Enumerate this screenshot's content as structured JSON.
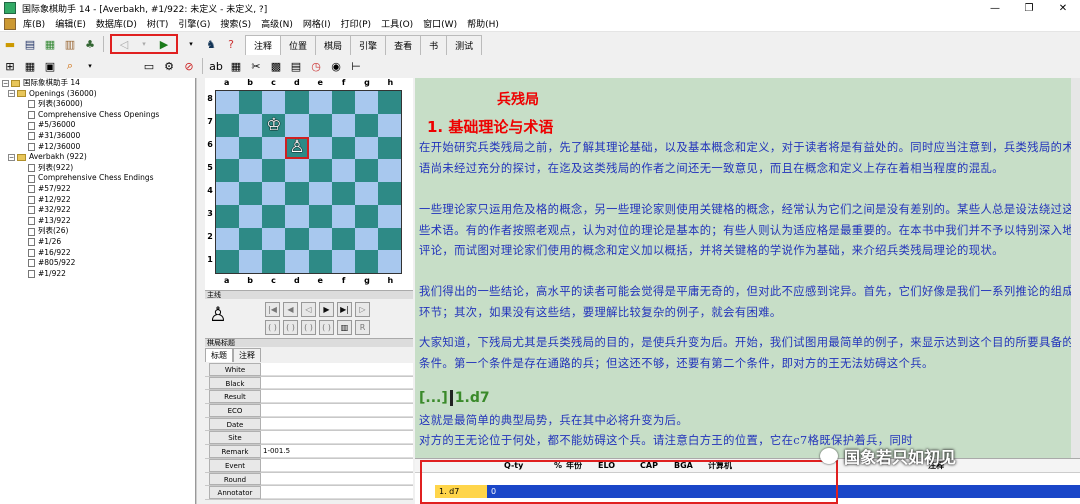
{
  "window": {
    "title": "国际象棋助手 14 - [Averbakh, #1/922: 未定义 - 未定义, ?]",
    "controls": [
      "minimize-icon",
      "restore-icon",
      "close-icon"
    ]
  },
  "menu": [
    "库(B)",
    "编辑(E)",
    "数据库(D)",
    "树(T)",
    "引擎(G)",
    "搜索(S)",
    "高级(N)",
    "网格(I)",
    "打印(P)",
    "工具(O)",
    "窗口(W)",
    "帮助(H)"
  ],
  "toolbar": {
    "tabs": [
      "注释",
      "位置",
      "棋局",
      "引擎",
      "查看",
      "书",
      "测试"
    ],
    "active_tab": "注释"
  },
  "tree": {
    "root": "国际象棋助手 14",
    "items": [
      {
        "label": "Openings (36000)",
        "level": 1,
        "type": "folder"
      },
      {
        "label": "列表(36000)",
        "level": 2,
        "type": "doc"
      },
      {
        "label": "Comprehensive Chess Openings",
        "level": 2,
        "type": "doc"
      },
      {
        "label": "#5/36000",
        "level": 2,
        "type": "doc"
      },
      {
        "label": "#31/36000",
        "level": 2,
        "type": "doc"
      },
      {
        "label": "#12/36000",
        "level": 2,
        "type": "doc"
      },
      {
        "label": "Averbakh (922)",
        "level": 1,
        "type": "folder"
      },
      {
        "label": "列表(922)",
        "level": 2,
        "type": "doc"
      },
      {
        "label": "Comprehensive Chess Endings",
        "level": 2,
        "type": "doc"
      },
      {
        "label": "#57/922",
        "level": 2,
        "type": "doc"
      },
      {
        "label": "#12/922",
        "level": 2,
        "type": "doc"
      },
      {
        "label": "#32/922",
        "level": 2,
        "type": "doc"
      },
      {
        "label": "#13/922",
        "level": 2,
        "type": "doc"
      },
      {
        "label": "列表(26)",
        "level": 2,
        "type": "doc"
      },
      {
        "label": "#1/26",
        "level": 2,
        "type": "doc"
      },
      {
        "label": "#16/922",
        "level": 2,
        "type": "doc"
      },
      {
        "label": "#805/922",
        "level": 2,
        "type": "doc"
      },
      {
        "label": "#1/922",
        "level": 2,
        "type": "doc"
      }
    ]
  },
  "board": {
    "files": [
      "a",
      "b",
      "c",
      "d",
      "e",
      "f",
      "g",
      "h"
    ],
    "ranks": [
      "8",
      "7",
      "6",
      "5",
      "4",
      "3",
      "2",
      "1"
    ],
    "pieces": [
      {
        "square": "c7",
        "glyph": "♔",
        "name": "white-king"
      },
      {
        "square": "d6",
        "glyph": "♙",
        "name": "white-pawn"
      }
    ],
    "highlight": "d6"
  },
  "panels": {
    "moves_title": "主线",
    "moves_piece": "♙",
    "header_title": "棋局标题",
    "header_tabs": [
      "标题",
      "注释"
    ]
  },
  "header_fields": [
    {
      "key": "White",
      "value": ""
    },
    {
      "key": "Black",
      "value": ""
    },
    {
      "key": "Result",
      "value": ""
    },
    {
      "key": "ECO",
      "value": ""
    },
    {
      "key": "Date",
      "value": ""
    },
    {
      "key": "Site",
      "value": ""
    },
    {
      "key": "Remark",
      "value": "1-001.5"
    },
    {
      "key": "Event",
      "value": ""
    },
    {
      "key": "Round",
      "value": ""
    },
    {
      "key": "Annotator",
      "value": ""
    }
  ],
  "text": {
    "title": "兵残局",
    "heading": "1. 基础理论与术语",
    "paragraphs": [
      "  在开始研究兵类残局之前，先了解其理论基础，以及基本概念和定义，对于读者将是有益处的。同时应当注意到，兵类残局的术语尚未经过充分的探讨，在迄及这类残局的作者之间还无一致意见，而且在概念和定义上存在着相当程度的混乱。",
      "  一些理论家只运用危及格的概念，另一些理论家则使用关键格的概念，经常认为它们之间是没有差别的。某些人总是设法绕过这些术语。有的作者按照老观点，认为对位的理论是基本的；有些人则认为适应格是最重要的。在本书中我们并不予以特别深入地评论，而试图对理论家们使用的概念和定义加以概括，并将关键格的学说作为基础，来介绍兵类残局理论的现状。",
      "  我们得出的一些结论，高水平的读者可能会觉得是平庸无奇的，但对此不应感到诧异。首先，它们好像是我们一系列推论的组成环节；其次，如果没有这些结，要理解比较复杂的例子，就会有困难。",
      "  大家知道，下残局尤其是兵类残局的目的，是使兵升变为后。开始，我们试图用最简单的例子，来显示达到这个目的所要具备的条件。第一个条件是存在通路的兵；但这还不够，还要有第二个条件，即对方的王无法妨碍这个兵。"
    ],
    "move_dots": "[...]",
    "move": "1.d7",
    "tail": [
      "这就是最简单的典型局势，兵在其中必将升变为后。",
      "  对方的王无论位于何处，都不能妨碍这个兵。请注意白方王的位置，它在c7格既保护着兵，同时"
    ]
  },
  "engine": {
    "columns": [
      "",
      "Q-ty",
      "%",
      "年份",
      "ELO",
      "CAP",
      "BGA",
      "计算机",
      "注释"
    ],
    "row": {
      "move": "1. d7",
      "count": "0"
    }
  },
  "watermark": "国象若只如初见"
}
